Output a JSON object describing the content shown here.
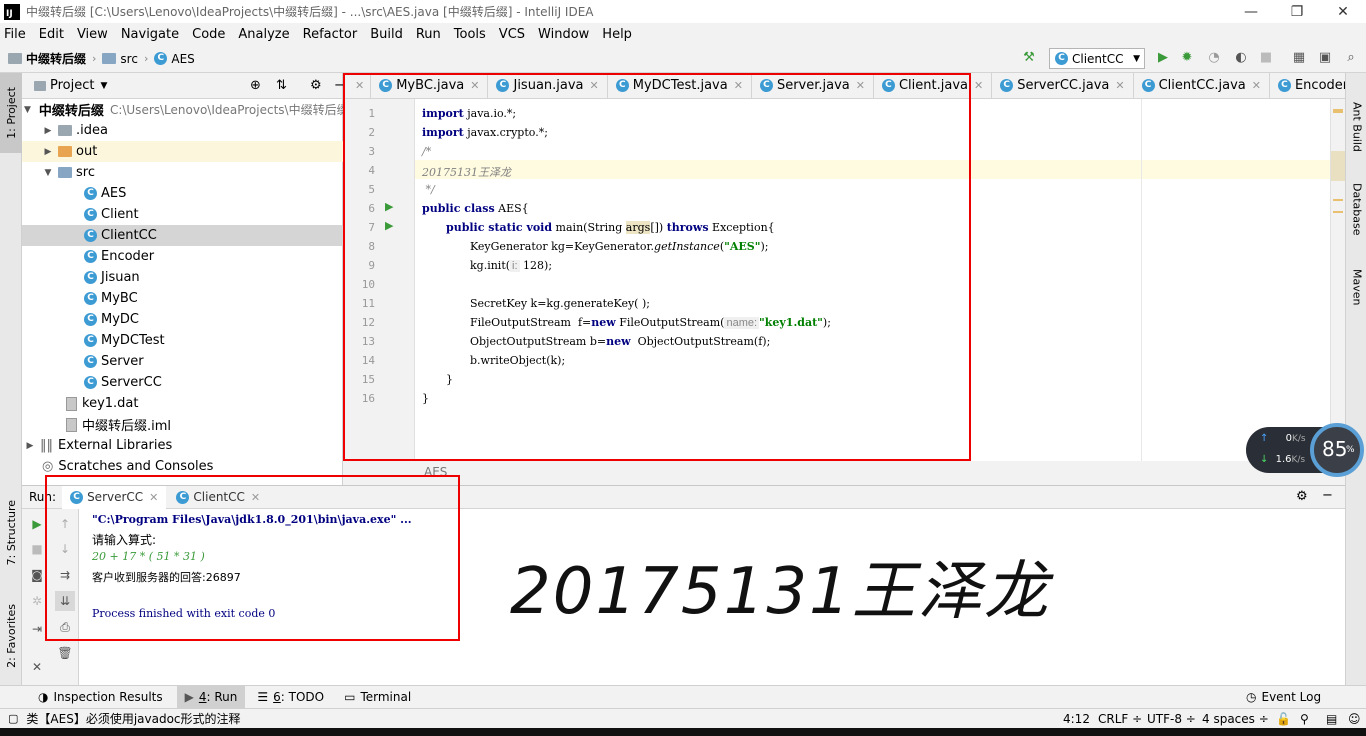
{
  "window": {
    "title": "中缀转后缀 [C:\\Users\\Lenovo\\IdeaProjects\\中缀转后缀] - ...\\src\\AES.java [中缀转后缀] - IntelliJ IDEA",
    "logo": "IJ",
    "min": "—",
    "max": "❐",
    "close": "✕"
  },
  "menu": [
    "File",
    "Edit",
    "View",
    "Navigate",
    "Code",
    "Analyze",
    "Refactor",
    "Build",
    "Run",
    "Tools",
    "VCS",
    "Window",
    "Help"
  ],
  "nav": {
    "project": "中缀转后缀",
    "folder": "src",
    "file": "AES",
    "run_config": "ClientCC"
  },
  "left_strip": {
    "project_tab": "1: Project",
    "structure_tab": "7: Structure",
    "favorites_tab": "2: Favorites"
  },
  "right_strip": {
    "ant": "Ant Build",
    "database": "Database",
    "maven": "Maven"
  },
  "project_panel": {
    "title": "Project",
    "root_name": "中缀转后缀",
    "root_path": "C:\\Users\\Lenovo\\IdeaProjects\\中缀转后缀",
    "idea": ".idea",
    "out": "out",
    "src": "src",
    "classes": [
      "AES",
      "Client",
      "ClientCC",
      "Encoder",
      "Jisuan",
      "MyBC",
      "MyDC",
      "MyDCTest",
      "Server",
      "ServerCC"
    ],
    "selected_class": "ClientCC",
    "key_file": "key1.dat",
    "iml_file": "中缀转后缀.iml",
    "external_libs": "External Libraries",
    "scratches": "Scratches and Consoles"
  },
  "editor_tabs": [
    "MyBC.java",
    "Jisuan.java",
    "MyDCTest.java",
    "Server.java",
    "Client.java",
    "ServerCC.java",
    "ClientCC.java",
    "Encoder.java"
  ],
  "editor": {
    "line_numbers": [
      "1",
      "2",
      "3",
      "4",
      "5",
      "6",
      "7",
      "8",
      "9",
      "10",
      "11",
      "12",
      "13",
      "14",
      "15",
      "16"
    ],
    "l1_kw": "import",
    "l1_rest": " java.io.*;",
    "l2_kw": "import",
    "l2_rest": " javax.crypto.*;",
    "l3": "/*",
    "l4": "20175131王泽龙",
    "l5": " */",
    "l6_kw": "public class",
    "l6_rest": " AES{",
    "l7_kw": "public static void",
    "l7_a": " main(String ",
    "l7_var": "args",
    "l7_b": "[]) ",
    "l7_kw2": "throws",
    "l7_c": " Exception{",
    "l8_a": "KeyGenerator kg=KeyGenerator.",
    "l8_it": "getInstance",
    "l8_b": "(",
    "l8_str": "\"AES\"",
    "l8_c": ");",
    "l9_a": "kg.init(",
    "l9_hint": "i:",
    "l9_b": " 128);",
    "l11": "SecretKey k=kg.generateKey( );",
    "l12_a": "FileOutputStream  f=",
    "l12_kw": "new",
    "l12_b": " FileOutputStream(",
    "l12_hint": "name:",
    "l12_str": "\"key1.dat\"",
    "l12_c": ");",
    "l13_a": "ObjectOutputStream b=",
    "l13_kw": "new",
    "l13_b": "  ObjectOutputStream(f);",
    "l14": "b.writeObject(k);",
    "l15": "}",
    "l16": "}",
    "footer": "AES"
  },
  "run_panel": {
    "label": "Run:",
    "tabs": [
      "ServerCC",
      "ClientCC"
    ],
    "console": {
      "cmd": "\"C:\\Program Files\\Java\\jdk1.8.0_201\\bin\\java.exe\" ...",
      "prompt": "请输入算式:",
      "input": "20 + 17 * ( 51 * 31 )",
      "answer": "客户收到服务器的回答:26897",
      "exit": "Process finished with exit code 0"
    },
    "overlay_text": "20175131王泽龙"
  },
  "net_widget": {
    "up": "0",
    "up_unit": "K/s",
    "down": "1.6",
    "down_unit": "K/s",
    "percent": "85",
    "percent_sign": "%"
  },
  "bottom_tabs": {
    "inspection": "Inspection Results",
    "run_num": "4",
    "run": ": Run",
    "todo_num": "6",
    "todo": ": TODO",
    "terminal": "Terminal",
    "event_log": "Event Log"
  },
  "status": {
    "message": "类【AES】必须使用javadoc形式的注释",
    "position": "4:12",
    "line_sep": "CRLF",
    "encoding": "UTF-8",
    "indent": "4 spaces"
  },
  "colors": {
    "annotation_red": "#e00000",
    "keyword": "#000080",
    "string": "#008000",
    "run_green": "#3a9a3a"
  }
}
